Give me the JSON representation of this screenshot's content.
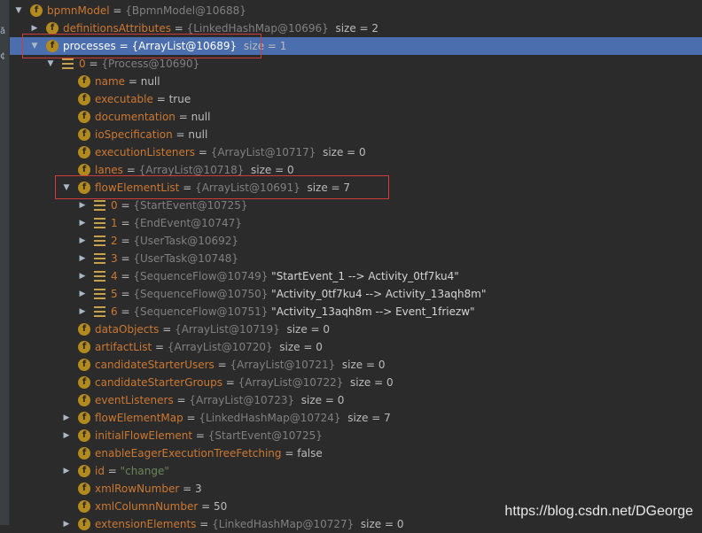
{
  "gutter_chars": [
    "å",
    "¢"
  ],
  "rows": [
    {
      "id": "r0",
      "indent": 0,
      "arrow": "down",
      "icon": "f",
      "name": "bpmnModel",
      "eq": " = ",
      "ref": "{BpmnModel@10688}",
      "tail": ""
    },
    {
      "id": "r1",
      "indent": 1,
      "arrow": "right",
      "icon": "f",
      "name": "definitionsAttributes",
      "eq": " = ",
      "ref": "{LinkedHashMap@10696}",
      "tail": "  size = 2"
    },
    {
      "id": "r2",
      "indent": 1,
      "arrow": "down",
      "icon": "f",
      "name": "processes",
      "eq": " = ",
      "ref": "{ArrayList@10689}",
      "tail": "  size = 1",
      "selected": true
    },
    {
      "id": "r3",
      "indent": 2,
      "arrow": "down",
      "icon": "list",
      "name": "0",
      "eq": " = ",
      "ref": "{Process@10690}",
      "tail": ""
    },
    {
      "id": "r4",
      "indent": 3,
      "arrow": "",
      "icon": "f",
      "name": "name",
      "eq": " = ",
      "ref": "",
      "tail": "null"
    },
    {
      "id": "r5",
      "indent": 3,
      "arrow": "",
      "icon": "f",
      "name": "executable",
      "eq": " = ",
      "ref": "",
      "tail": "true"
    },
    {
      "id": "r6",
      "indent": 3,
      "arrow": "",
      "icon": "f",
      "name": "documentation",
      "eq": " = ",
      "ref": "",
      "tail": "null"
    },
    {
      "id": "r7",
      "indent": 3,
      "arrow": "",
      "icon": "f",
      "name": "ioSpecification",
      "eq": " = ",
      "ref": "",
      "tail": "null"
    },
    {
      "id": "r8",
      "indent": 3,
      "arrow": "",
      "icon": "f",
      "name": "executionListeners",
      "eq": " = ",
      "ref": "{ArrayList@10717}",
      "tail": "  size = 0"
    },
    {
      "id": "r9",
      "indent": 3,
      "arrow": "",
      "icon": "f",
      "name": "lanes",
      "eq": " = ",
      "ref": "{ArrayList@10718}",
      "tail": "  size = 0"
    },
    {
      "id": "r10",
      "indent": 3,
      "arrow": "down",
      "icon": "f",
      "name": "flowElementList",
      "eq": " = ",
      "ref": "{ArrayList@10691}",
      "tail": "  size = 7"
    },
    {
      "id": "r11",
      "indent": 4,
      "arrow": "right",
      "icon": "list",
      "name": "0",
      "eq": " = ",
      "ref": "{StartEvent@10725}",
      "tail": ""
    },
    {
      "id": "r12",
      "indent": 4,
      "arrow": "right",
      "icon": "list",
      "name": "1",
      "eq": " = ",
      "ref": "{EndEvent@10747}",
      "tail": ""
    },
    {
      "id": "r13",
      "indent": 4,
      "arrow": "right",
      "icon": "list",
      "name": "2",
      "eq": " = ",
      "ref": "{UserTask@10692}",
      "tail": ""
    },
    {
      "id": "r14",
      "indent": 4,
      "arrow": "right",
      "icon": "list",
      "name": "3",
      "eq": " = ",
      "ref": "{UserTask@10748}",
      "tail": ""
    },
    {
      "id": "r15",
      "indent": 4,
      "arrow": "right",
      "icon": "list",
      "name": "4",
      "eq": " = ",
      "ref": "{SequenceFlow@10749}",
      "tail": " \"StartEvent_1 --> Activity_0tf7ku4\"",
      "tailStyle": "strw"
    },
    {
      "id": "r16",
      "indent": 4,
      "arrow": "right",
      "icon": "list",
      "name": "5",
      "eq": " = ",
      "ref": "{SequenceFlow@10750}",
      "tail": " \"Activity_0tf7ku4 --> Activity_13aqh8m\"",
      "tailStyle": "strw"
    },
    {
      "id": "r17",
      "indent": 4,
      "arrow": "right",
      "icon": "list",
      "name": "6",
      "eq": " = ",
      "ref": "{SequenceFlow@10751}",
      "tail": " \"Activity_13aqh8m --> Event_1friezw\"",
      "tailStyle": "strw"
    },
    {
      "id": "r18",
      "indent": 3,
      "arrow": "",
      "icon": "f",
      "name": "dataObjects",
      "eq": " = ",
      "ref": "{ArrayList@10719}",
      "tail": "  size = 0"
    },
    {
      "id": "r19",
      "indent": 3,
      "arrow": "",
      "icon": "f",
      "name": "artifactList",
      "eq": " = ",
      "ref": "{ArrayList@10720}",
      "tail": "  size = 0"
    },
    {
      "id": "r20",
      "indent": 3,
      "arrow": "",
      "icon": "f",
      "name": "candidateStarterUsers",
      "eq": " = ",
      "ref": "{ArrayList@10721}",
      "tail": "  size = 0"
    },
    {
      "id": "r21",
      "indent": 3,
      "arrow": "",
      "icon": "f",
      "name": "candidateStarterGroups",
      "eq": " = ",
      "ref": "{ArrayList@10722}",
      "tail": "  size = 0"
    },
    {
      "id": "r22",
      "indent": 3,
      "arrow": "",
      "icon": "f",
      "name": "eventListeners",
      "eq": " = ",
      "ref": "{ArrayList@10723}",
      "tail": "  size = 0"
    },
    {
      "id": "r23",
      "indent": 3,
      "arrow": "right",
      "icon": "f",
      "name": "flowElementMap",
      "eq": " = ",
      "ref": "{LinkedHashMap@10724}",
      "tail": "  size = 7"
    },
    {
      "id": "r24",
      "indent": 3,
      "arrow": "right",
      "icon": "f",
      "name": "initialFlowElement",
      "eq": " = ",
      "ref": "{StartEvent@10725}",
      "tail": ""
    },
    {
      "id": "r25",
      "indent": 3,
      "arrow": "",
      "icon": "f",
      "name": "enableEagerExecutionTreeFetching",
      "eq": " = ",
      "ref": "",
      "tail": "false"
    },
    {
      "id": "r26",
      "indent": 3,
      "arrow": "right",
      "icon": "f",
      "name": "id",
      "eq": " = ",
      "ref": "",
      "tail": "\"change\"",
      "tailStyle": "str"
    },
    {
      "id": "r27",
      "indent": 3,
      "arrow": "",
      "icon": "f",
      "name": "xmlRowNumber",
      "eq": " = ",
      "ref": "",
      "tail": "3"
    },
    {
      "id": "r28",
      "indent": 3,
      "arrow": "",
      "icon": "f",
      "name": "xmlColumnNumber",
      "eq": " = ",
      "ref": "",
      "tail": "50"
    },
    {
      "id": "r29",
      "indent": 3,
      "arrow": "right",
      "icon": "f",
      "name": "extensionElements",
      "eq": " = ",
      "ref": "{LinkedHashMap@10727}",
      "tail": "  size = 0"
    }
  ],
  "watermark": "https://blog.csdn.net/DGeorge",
  "colors": {
    "selection": "#4b6eaf",
    "highlight_box": "#d03a3a",
    "field_icon": "#b38a1e"
  }
}
